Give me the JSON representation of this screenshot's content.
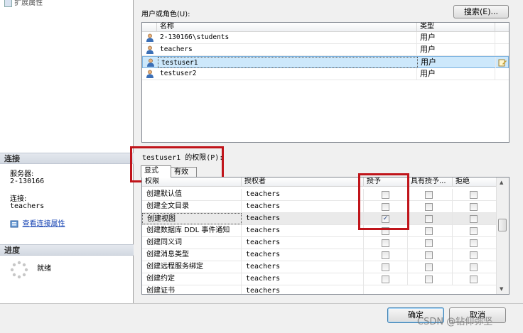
{
  "left": {
    "top_label": "扩展属性",
    "connection": {
      "header": "连接",
      "server_label": "服务器:",
      "server_value": "2-130166",
      "connection_label": "连接:",
      "connection_value": "teachers",
      "view_link": "查看连接属性"
    },
    "progress": {
      "header": "进度",
      "status": "就绪"
    }
  },
  "users_section": {
    "label": "用户或角色(U):",
    "search_button": "搜索(E)...",
    "columns": [
      "名称",
      "类型"
    ],
    "rows": [
      {
        "name": "2-130166\\students",
        "type": "用户"
      },
      {
        "name": "teachers",
        "type": "用户"
      },
      {
        "name": "testuser1",
        "type": "用户"
      },
      {
        "name": "testuser2",
        "type": "用户"
      }
    ]
  },
  "permissions_section": {
    "label": "testuser1 的权限(P):",
    "tabs": [
      "显式",
      "有效"
    ],
    "columns": [
      "权限",
      "授权者",
      "授予",
      "具有授予...",
      "拒绝"
    ],
    "rows": [
      {
        "perm": "创建默认值",
        "grantor": "teachers"
      },
      {
        "perm": "创建全文目录",
        "grantor": "teachers"
      },
      {
        "perm": "创建视图",
        "grantor": "teachers",
        "grant_mark": "✓"
      },
      {
        "perm": "创建数据库 DDL 事件通知",
        "grantor": "teachers"
      },
      {
        "perm": "创建同义词",
        "grantor": "teachers"
      },
      {
        "perm": "创建消息类型",
        "grantor": "teachers"
      },
      {
        "perm": "创建远程服务绑定",
        "grantor": "teachers"
      },
      {
        "perm": "创建约定",
        "grantor": "teachers"
      },
      {
        "perm": "创建证书",
        "grantor": "teachers"
      }
    ]
  },
  "footer": {
    "ok_button": "确定",
    "cancel_button": "取消"
  },
  "watermark": "CSDN @钻仰弥坚",
  "colors": {
    "highlight_box": "#c0141a",
    "selection": "#cde8fb"
  }
}
